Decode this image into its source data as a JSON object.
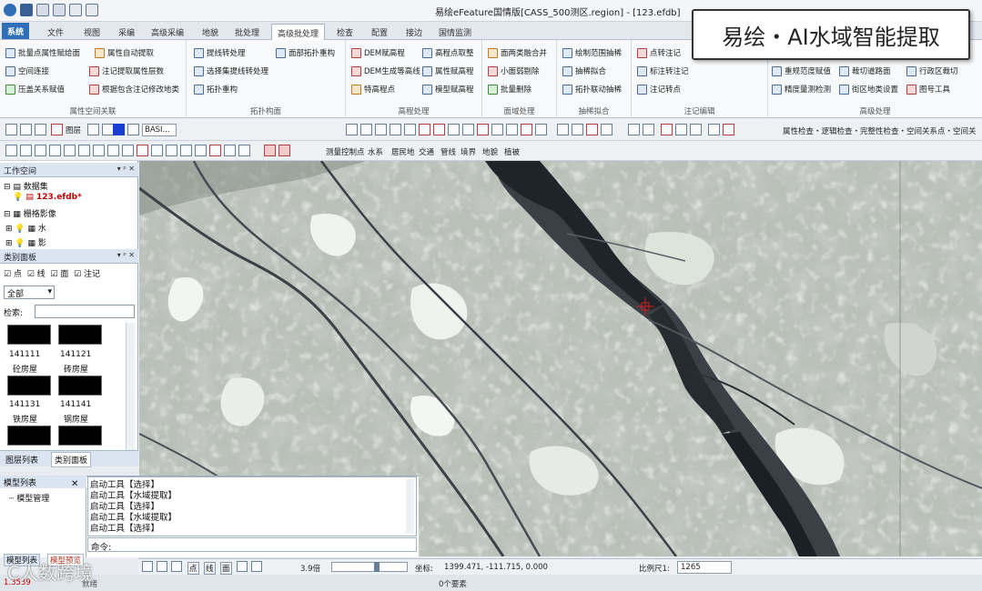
{
  "window": {
    "title": "易绘eFeature国情版[CASS_500测区.region] - [123.efdb]"
  },
  "overlay_banner": "易绘・AI水域智能提取",
  "watermark": "C人数跨境",
  "tabs": [
    {
      "label": "系统",
      "type": "sys"
    },
    {
      "label": "文件"
    },
    {
      "label": "视图"
    },
    {
      "label": "采编"
    },
    {
      "label": "高级采编"
    },
    {
      "label": "地貌"
    },
    {
      "label": "批处理"
    },
    {
      "label": "高级批处理",
      "active": true
    },
    {
      "label": "检查"
    },
    {
      "label": "配置"
    },
    {
      "label": "接边"
    },
    {
      "label": "国情监测"
    }
  ],
  "ribbon": {
    "groups": [
      {
        "label": "属性空间关联",
        "items": [
          "批量点属性赋给面",
          "属性自动提取",
          "空间连接",
          "注记提取属性层数",
          "压盖关系赋值",
          "根据包含注记修改地类"
        ]
      },
      {
        "label": "拓扑构面",
        "items": [
          "提线转处理",
          "面部拓扑重构",
          "选择集提线转处理",
          "拓扑重构"
        ]
      },
      {
        "label": "高程处理",
        "items": [
          "DEM赋高程",
          "高程点取整",
          "DEM生成等高线",
          "属性赋高程",
          "特高程点",
          "模型赋高程"
        ]
      },
      {
        "label": "面域处理",
        "items": [
          "面两类融合并",
          "小面弱剔除",
          "批量删除"
        ]
      },
      {
        "label": "抽稀拟合",
        "items": [
          "绘制范围抽稀",
          "抽稀拟合",
          "拓扑联动抽稀"
        ]
      },
      {
        "label": "注记编辑",
        "items": [
          "点转注记",
          "标注转注记",
          "注记转点"
        ]
      },
      {
        "label": "高级处理",
        "items": [
          "重规范度赋值",
          "裁切道路面",
          "行政区裁切",
          "精度量测检测",
          "街区地类设置",
          "图号工具"
        ]
      }
    ]
  },
  "toolbar1": {
    "layer_label": "图层",
    "combo_value": "BASI...",
    "right_text": "属性检查・逻辑检查・完整性检查・空间关系点・空间关"
  },
  "toolbar2": {
    "layers": [
      "测量控制点",
      "水系",
      "居民地",
      "交通",
      "管线",
      "境界",
      "地貌",
      "植被"
    ]
  },
  "workspace": {
    "title": "工作空间",
    "items": [
      {
        "label": "数据集"
      },
      {
        "label": "123.efdb*",
        "highlight": true
      },
      {
        "label": "栅格影像"
      },
      {
        "label": "水"
      },
      {
        "label": "影"
      }
    ]
  },
  "class_panel": {
    "title": "类别面板",
    "checks": [
      "点",
      "线",
      "面",
      "注记"
    ],
    "filter_value": "全部",
    "search_label": "检索:",
    "cells": [
      {
        "code": "141111",
        "name": "砼房屋"
      },
      {
        "code": "141121",
        "name": "砖房屋"
      },
      {
        "code": "141131",
        "name": "铁房屋"
      },
      {
        "code": "141141",
        "name": "钢房屋"
      }
    ],
    "tabs": [
      "图层列表",
      "类别面板"
    ]
  },
  "model_panel": {
    "title": "模型列表",
    "item": "模型管理",
    "tabs": [
      "模型列表",
      "模型预览"
    ]
  },
  "command_log": {
    "lines": [
      "启动工具【选择】",
      "启动工具【水域提取】",
      "启动工具【选择】",
      "启动工具【水域提取】",
      "启动工具【选择】"
    ],
    "prompt": "命令:"
  },
  "statusbar": {
    "tools": [
      "点",
      "线",
      "面"
    ],
    "zoom": "3.9倍",
    "coords_label": "坐标:",
    "coords": "1399.471,  -111.715,  0.000",
    "scale_label": "比例尺1:",
    "scale_value": "1265",
    "elements": "0个要素",
    "left_code": "1.3539",
    "left_sub": "就绪"
  },
  "colors": {
    "accent": "#2f6fb8",
    "river_dark": "#1d2226",
    "land_gray": "#8f9690",
    "land_light": "#dde3dc"
  }
}
